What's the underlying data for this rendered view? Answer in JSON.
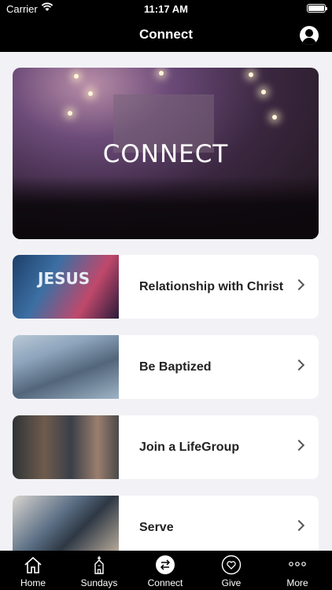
{
  "status": {
    "carrier": "Carrier",
    "time": "11:17 AM"
  },
  "nav": {
    "title": "Connect",
    "profile_icon": "person-icon"
  },
  "hero": {
    "title": "CONNECT"
  },
  "cards": [
    {
      "label": "Relationship with Christ",
      "thumb_text": "JESUS"
    },
    {
      "label": "Be Baptized"
    },
    {
      "label": "Join a LifeGroup"
    },
    {
      "label": "Serve"
    }
  ],
  "tabs": [
    {
      "label": "Home",
      "icon": "house-icon"
    },
    {
      "label": "Sundays",
      "icon": "church-icon"
    },
    {
      "label": "Connect",
      "icon": "swap-arrows-icon"
    },
    {
      "label": "Give",
      "icon": "heart-icon"
    },
    {
      "label": "More",
      "icon": "ellipsis-icon"
    }
  ]
}
